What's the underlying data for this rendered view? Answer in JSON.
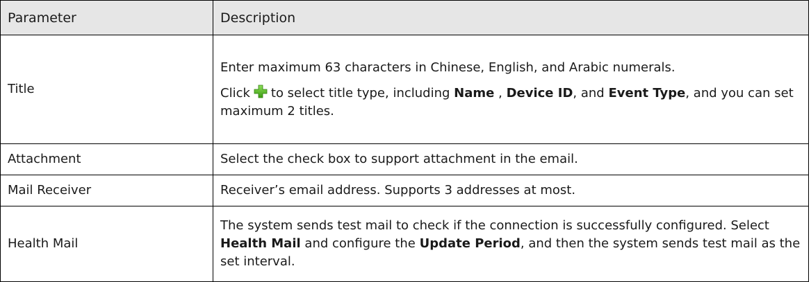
{
  "table": {
    "header": {
      "parameter": "Parameter",
      "description": "Description"
    },
    "rows": {
      "title": {
        "parameter": "Title",
        "line1": "Enter maximum 63 characters in Chinese, English, and Arabic numerals.",
        "click": "Click",
        "line2a": "to select title type, including",
        "name": "Name",
        "comma": ",",
        "device_id": "Device ID",
        "and": ", and",
        "event_type": "Event Type",
        "line2b": ", and you can set maximum 2 titles.",
        "icon": "add-icon",
        "icon_color": "#4caf1a"
      },
      "attachment": {
        "parameter": "Attachment",
        "description": "Select the check box to support attachment in the email."
      },
      "receiver": {
        "parameter": "Mail Receiver",
        "description": "Receiver’s email address. Supports 3 addresses at most."
      },
      "health": {
        "parameter": "Health Mail",
        "p1": "The system sends test mail to check if the connection is successfully configured. Select",
        "health_mail": "Health Mail",
        "p2": "and configure the",
        "update_period": "Update Period",
        "p3": ", and then the system sends test mail as the set interval."
      }
    }
  }
}
